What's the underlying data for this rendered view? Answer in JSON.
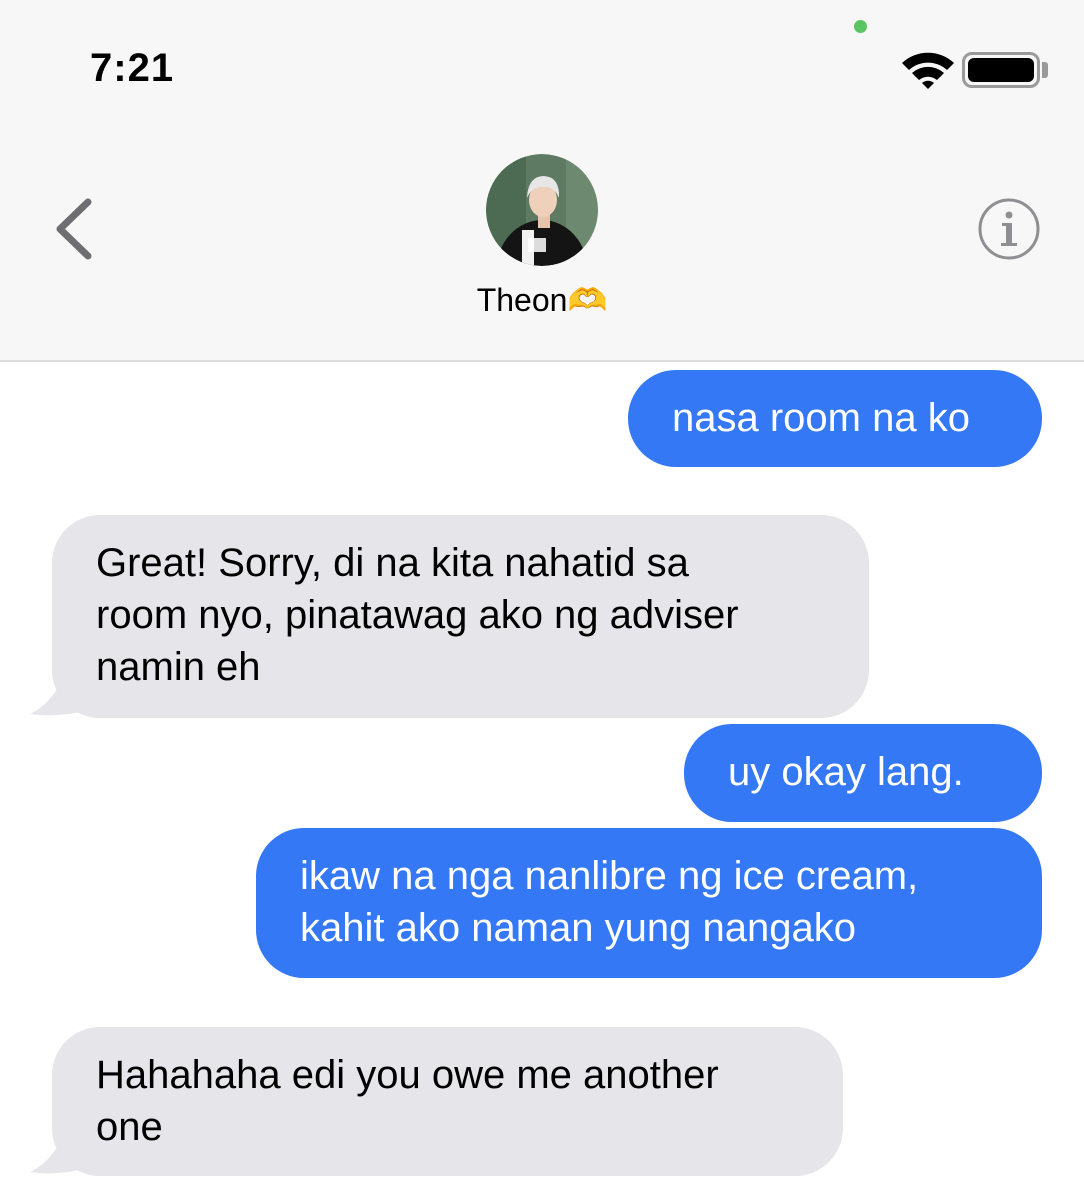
{
  "status_bar": {
    "time": "7:21",
    "icons": [
      "microphone-indicator-dot",
      "wifi-icon",
      "battery-icon"
    ],
    "mic_indicator_color": "#5ac462"
  },
  "nav": {
    "back_icon": "chevron-left-icon",
    "contact_name": "Theon🫶",
    "info_icon": "info-icon"
  },
  "colors": {
    "outgoing_bubble": "#3478f6",
    "incoming_bubble": "#e5e5ea",
    "header_bg": "#f7f7f7"
  },
  "messages": [
    {
      "direction": "outgoing",
      "lines": [
        "nasa room na ko"
      ]
    },
    {
      "direction": "incoming",
      "lines": [
        "Great! Sorry, di na kita nahatid sa",
        "room nyo, pinatawag ako ng adviser",
        "namin eh"
      ]
    },
    {
      "direction": "outgoing",
      "lines": [
        "uy okay lang."
      ]
    },
    {
      "direction": "outgoing",
      "lines": [
        "ikaw na nga nanlibre ng ice cream,",
        "kahit ako naman yung nangako"
      ]
    },
    {
      "direction": "incoming",
      "lines": [
        "Hahahaha edi you owe me another",
        "one"
      ]
    }
  ]
}
